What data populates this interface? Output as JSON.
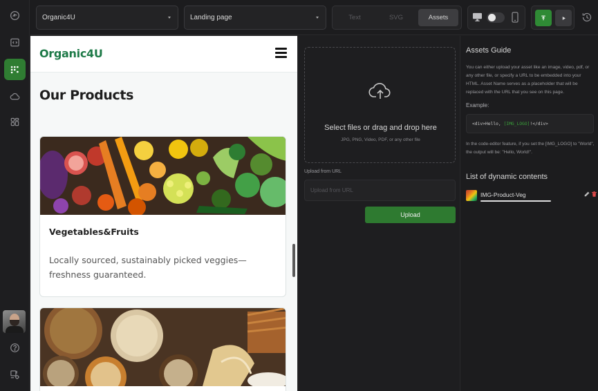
{
  "topbar": {
    "project_select": "Organic4U",
    "page_select": "Landing page",
    "tabs": [
      {
        "label": "Text",
        "active": false
      },
      {
        "label": "SVG",
        "active": false
      },
      {
        "label": "Assets",
        "active": true
      }
    ],
    "device_icons": [
      "desktop-icon",
      "mobile-icon"
    ],
    "run_icons": [
      "deploy-icon",
      "play-icon"
    ],
    "history_icon": "history-icon"
  },
  "rail": {
    "items": [
      "logo-icon",
      "code-icon",
      "assets-icon",
      "cloud-icon",
      "templates-icon"
    ],
    "active_index": 2,
    "bottom_items": [
      "help-icon",
      "settings-icon"
    ]
  },
  "preview": {
    "logo": "Organic4U",
    "heading": "Our Products",
    "cards": [
      {
        "title": "Vegetables&Fruits",
        "description": "Locally sourced, sustainably picked veggies—freshness guaranteed."
      },
      {
        "title": "",
        "description": ""
      }
    ]
  },
  "upload": {
    "drop_title": "Select files or drag and drop here",
    "drop_sub": "JPG, PNG, Video, PDF, or any other file",
    "url_label": "Upload from URL",
    "url_placeholder": "Upload from URL",
    "url_value": "",
    "button": "Upload"
  },
  "guide": {
    "title": "Assets Guide",
    "text": "You can either upload your asset like an image, video, pdf, or any other file, or specify a URL to be embedded into your HTML. Asset Name serves as a placeholder that will be replaced with the URL that you see on this page.",
    "example_label": "Example:",
    "code_prefix": "<div>Hello, ",
    "code_placeholder": "[IMG_LOGO]",
    "code_suffix": "!</div>",
    "note": "In the code-editor feature, if you set the [IMG_LOGO] to \"World\", the output will be: \"Hello, World!\".",
    "list_title": "List of dynamic contents",
    "assets": [
      {
        "name": "IMG-Product-Veg"
      }
    ]
  },
  "colors": {
    "accent": "#2f7d32",
    "brand": "#1e7a48",
    "danger": "#e04a4a"
  }
}
